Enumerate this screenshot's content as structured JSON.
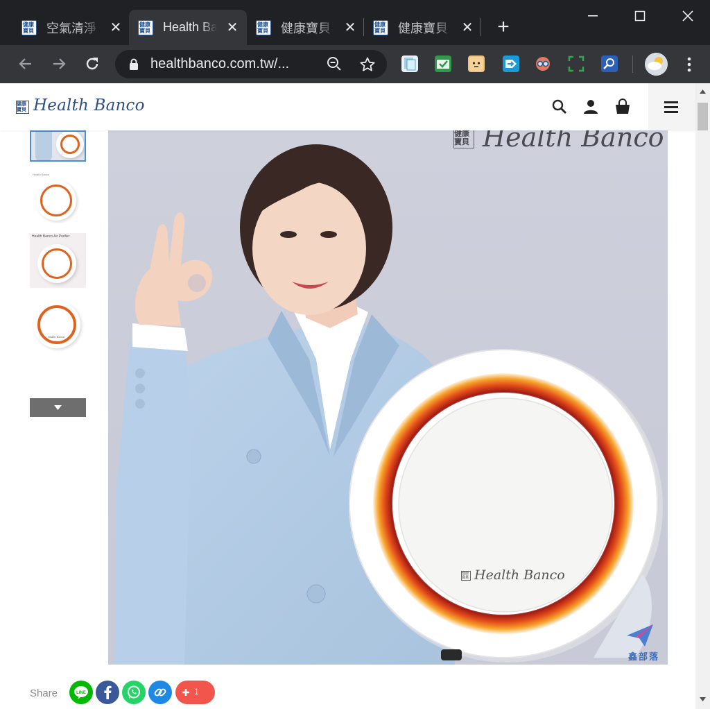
{
  "browser": {
    "tabs": [
      {
        "title": "空氣清淨",
        "favicon_text": "健康寶貝",
        "active": false
      },
      {
        "title": "Health Banco",
        "favicon_text": "健康寶貝",
        "active": true
      },
      {
        "title": "健康寶貝",
        "favicon_text": "健康寶貝",
        "active": false
      },
      {
        "title": "健康寶貝",
        "favicon_text": "健康寶貝",
        "active": false
      }
    ],
    "url": "healthbanco.com.tw/...",
    "window": {
      "minimize": "—",
      "maximize": "☐",
      "close": "✕"
    },
    "new_tab": "+"
  },
  "site": {
    "logo_mark": "健康寶貝",
    "logo_text": "Health Banco"
  },
  "hero": {
    "watermark_mark": "健康寶貝",
    "watermark_text": "Health Banco",
    "device_logo_mark": "健康寶貝",
    "device_logo_text": "Health Banco",
    "corner_badge": "鑫部落"
  },
  "thumbnails": [
    {
      "label": "",
      "selected": true
    },
    {
      "label": "Health Banco",
      "selected": false
    },
    {
      "label": "Health Banco Air Purifier",
      "selected": false
    },
    {
      "label": "Health Banco",
      "selected": false
    }
  ],
  "share": {
    "label": "Share",
    "count": "1",
    "buttons": [
      "line",
      "facebook",
      "whatsapp",
      "copy-link",
      "more"
    ]
  },
  "colors": {
    "brand_blue": "#2e4f86",
    "line_green": "#00b900",
    "facebook_blue": "#3b5998",
    "whatsapp_green": "#25d366",
    "link_blue": "#1e88e5",
    "more_red": "#f2554b",
    "ring_orange": "#e0621d"
  }
}
